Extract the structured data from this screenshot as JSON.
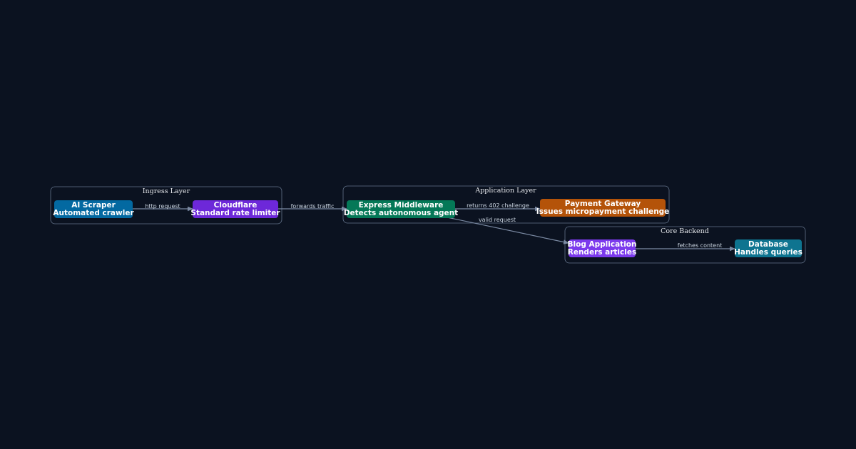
{
  "diagram": {
    "clusters": {
      "ingress": {
        "title": "Ingress Layer"
      },
      "application": {
        "title": "Application Layer"
      },
      "core": {
        "title": "Core Backend"
      }
    },
    "nodes": {
      "ai_scraper": {
        "line1": "AI Scraper",
        "line2": "Automated crawler",
        "color": "#0369a1"
      },
      "cloudflare": {
        "line1": "Cloudflare",
        "line2": "Standard rate limiter",
        "color": "#6d28d9"
      },
      "express": {
        "line1": "Express Middleware",
        "line2": "Detects autonomous agent",
        "color": "#047857"
      },
      "payment": {
        "line1": "Payment Gateway",
        "line2": "Issues micropayment challenge",
        "color": "#b45309"
      },
      "blog": {
        "line1": "Blog Application",
        "line2": "Renders articles",
        "color": "#7c3aed"
      },
      "database": {
        "line1": "Database",
        "line2": "Handles queries",
        "color": "#0e7490"
      }
    },
    "edges": {
      "scraper_to_cloudflare": "http request",
      "cloudflare_to_express": "forwards traffic",
      "express_to_payment": "returns 402 challenge",
      "express_to_blog": "valid request",
      "blog_to_database": "fetches content"
    },
    "background": "#0b1220",
    "edge_color": "#7b8aa3"
  }
}
